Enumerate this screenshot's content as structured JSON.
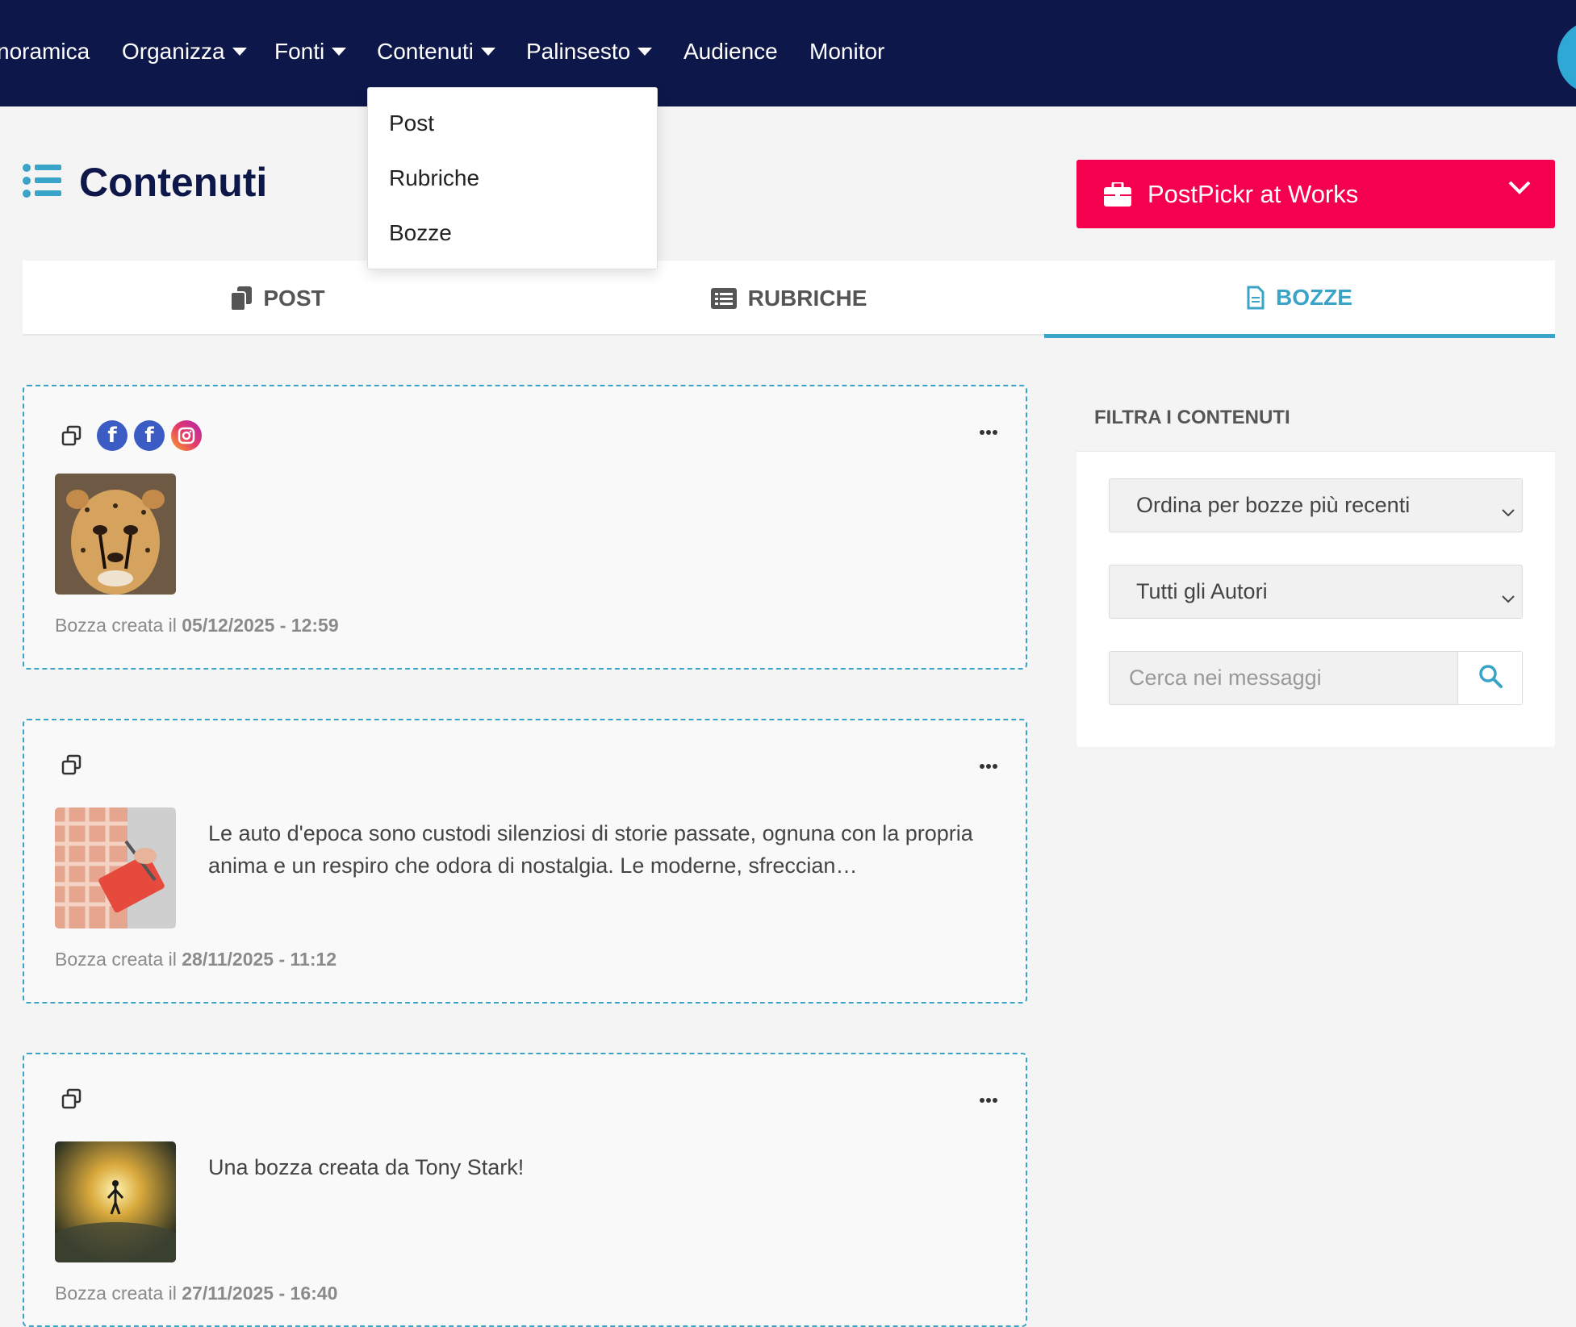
{
  "nav": {
    "items": [
      {
        "label": "noramica"
      },
      {
        "label": "Organizza"
      },
      {
        "label": "Fonti"
      },
      {
        "label": "Contenuti"
      },
      {
        "label": "Palinsesto"
      },
      {
        "label": "Audience"
      },
      {
        "label": "Monitor"
      }
    ],
    "dropdown": [
      "Post",
      "Rubriche",
      "Bozze"
    ]
  },
  "page": {
    "title": "Contenuti"
  },
  "company": {
    "name": "PostPickr at Works",
    "color": "#f5004f"
  },
  "tabs": [
    {
      "label": "POST",
      "icon": "copy-icon"
    },
    {
      "label": "RUBRICHE",
      "icon": "list-alt-icon"
    },
    {
      "label": "BOZZE",
      "icon": "file-icon",
      "active": true
    }
  ],
  "drafts": [
    {
      "networks": [
        "facebook",
        "facebook",
        "instagram"
      ],
      "image": "cheetah-photo",
      "text": "",
      "date_prefix": "Bozza creata il",
      "date": "05/12/2025 - 12:59"
    },
    {
      "networks": [],
      "image": "notebook-photo",
      "text": "Le auto d'epoca sono custodi silenziosi di storie passate, ognuna con la propria anima e un respiro che odora di nostalgia. Le moderne, sfreccian…",
      "date_prefix": "Bozza creata il",
      "date": "28/11/2025 - 11:12"
    },
    {
      "networks": [],
      "image": "flying-figure-photo",
      "text": "Una bozza creata da Tony Stark!",
      "date_prefix": "Bozza creata il",
      "date": "27/11/2025 - 16:40"
    }
  ],
  "filters": {
    "title": "FILTRA I CONTENUTI",
    "sort_value": "Ordina per bozze più recenti",
    "author_value": "Tutti gli Autori",
    "search_placeholder": "Cerca nei messaggi"
  },
  "colors": {
    "nav_bg": "#0e174a",
    "accent": "#3aa4c8",
    "brand": "#f5004f"
  }
}
